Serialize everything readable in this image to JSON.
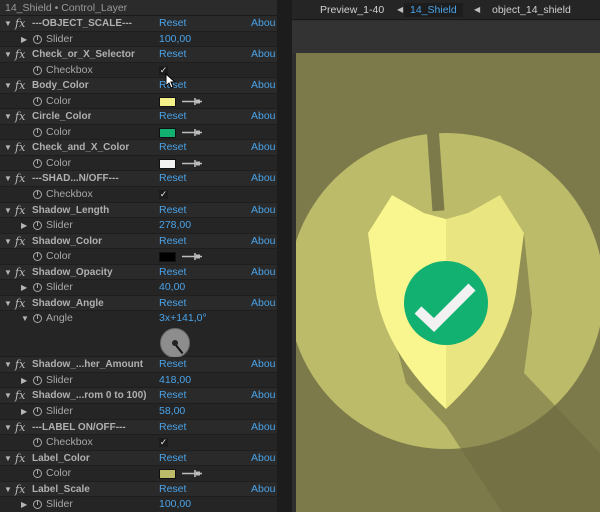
{
  "panel": {
    "header": "14_Shield • Control_Layer",
    "reset_label": "Reset",
    "about_label": "Abou",
    "effects": [
      {
        "name": "---OBJECT_SCALE---",
        "prop": "Slider",
        "kind": "slider",
        "value": "100,00"
      },
      {
        "name": "Check_or_X_Selector",
        "prop": "Checkbox",
        "kind": "checkbox",
        "checked": true
      },
      {
        "name": "Body_Color",
        "prop": "Color",
        "kind": "color",
        "color": "#f4f18a"
      },
      {
        "name": "Circle_Color",
        "prop": "Color",
        "kind": "color",
        "color": "#12b171"
      },
      {
        "name": "Check_and_X_Color",
        "prop": "Color",
        "kind": "color",
        "color": "#f2f2f2"
      },
      {
        "name": "---SHAD...N/OFF---",
        "prop": "Checkbox",
        "kind": "checkbox",
        "checked": true
      },
      {
        "name": "Shadow_Length",
        "prop": "Slider",
        "kind": "slider",
        "value": "278,00"
      },
      {
        "name": "Shadow_Color",
        "prop": "Color",
        "kind": "color",
        "color": "#000000"
      },
      {
        "name": "Shadow_Opacity",
        "prop": "Slider",
        "kind": "slider",
        "value": "40,00"
      },
      {
        "name": "Shadow_Angle",
        "prop": "Angle",
        "kind": "angle",
        "value": "3x+141,0°"
      },
      {
        "name": "Shadow_...her_Amount",
        "prop": "Slider",
        "kind": "slider",
        "value": "418,00"
      },
      {
        "name": "Shadow_...rom 0 to 100)",
        "prop": "Slider",
        "kind": "slider",
        "value": "58,00"
      },
      {
        "name": "---LABEL ON/OFF---",
        "prop": "Checkbox",
        "kind": "checkbox",
        "checked": true
      },
      {
        "name": "Label_Color",
        "prop": "Color",
        "kind": "color",
        "color": "#bcbb6a"
      },
      {
        "name": "Label_Scale",
        "prop": "Slider",
        "kind": "slider",
        "value": "100,00"
      }
    ]
  },
  "viewer": {
    "tabs": [
      {
        "label": "Preview_1-40",
        "active": false
      },
      {
        "label": "14_Shield",
        "active": true
      },
      {
        "label": "object_14_shield",
        "active": false
      }
    ],
    "colors": {
      "background": "#7c7a4a",
      "circle": "#bcbb6a",
      "shadow": "#6d6b3f",
      "shield_left": "#f9f68f",
      "shield_right": "#e9e580",
      "badge": "#12b171",
      "check": "#f2f2f2"
    }
  }
}
